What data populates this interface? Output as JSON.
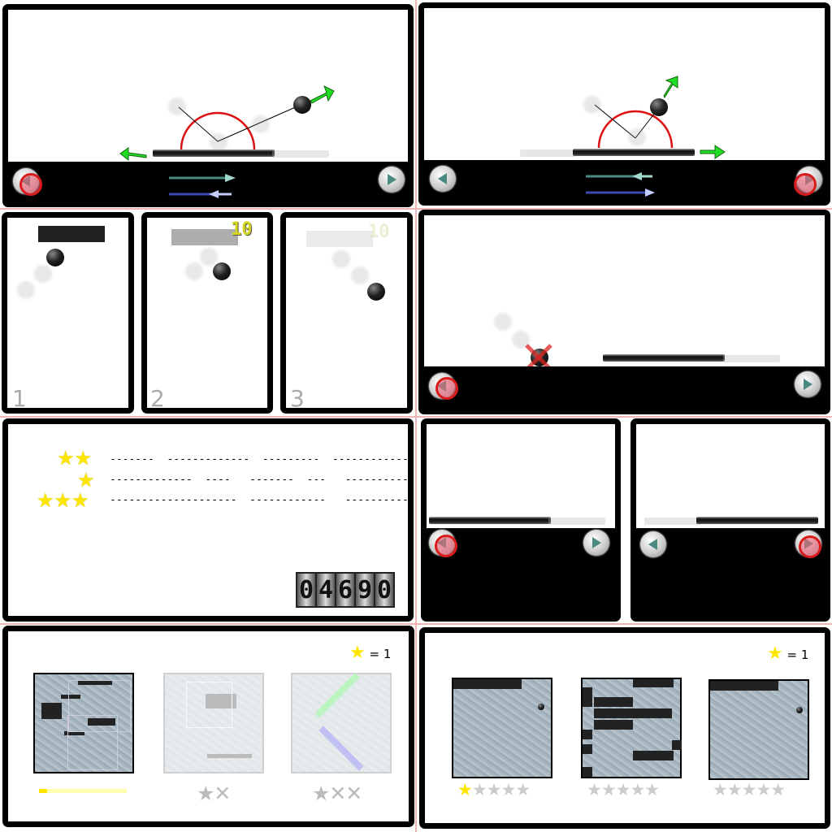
{
  "frames": {
    "f3": {
      "number": "1"
    },
    "f4": {
      "number": "2",
      "points": "10"
    },
    "f5": {
      "number": "3",
      "points": "10"
    }
  },
  "level_text": {
    "rows": [
      {
        "stars": "★★",
        "dashes": "-------  -------------  ---------  --------------"
      },
      {
        "stars": "★",
        "dashes": "-------------  ----   -------  ---   --------------"
      },
      {
        "stars": "★★★",
        "dashes": "--------------------  ------------   ------------"
      }
    ],
    "score_digits": [
      "0",
      "4",
      "6",
      "9",
      "0"
    ]
  },
  "level_select_a": {
    "star_legend": "= 1",
    "ratings": [
      "★",
      "★✕",
      "★✕✕"
    ]
  },
  "level_select_b": {
    "star_legend": "= 1",
    "ratings": [
      "★★★★★",
      "★★★★★",
      "★★★★★"
    ]
  },
  "colors": {
    "frame": "#000000",
    "arrow_green": "#22dd22",
    "arc_red": "#dd1111",
    "star_yellow": "#ffe600",
    "arrow_teal": "#4a8a80",
    "arrow_blue": "#3a4ab0",
    "touch_red": "#d81c1c"
  },
  "icons": {
    "prev": "left-arrow-icon",
    "next": "right-arrow-icon",
    "miss": "x-mark-icon",
    "star": "star-icon"
  }
}
